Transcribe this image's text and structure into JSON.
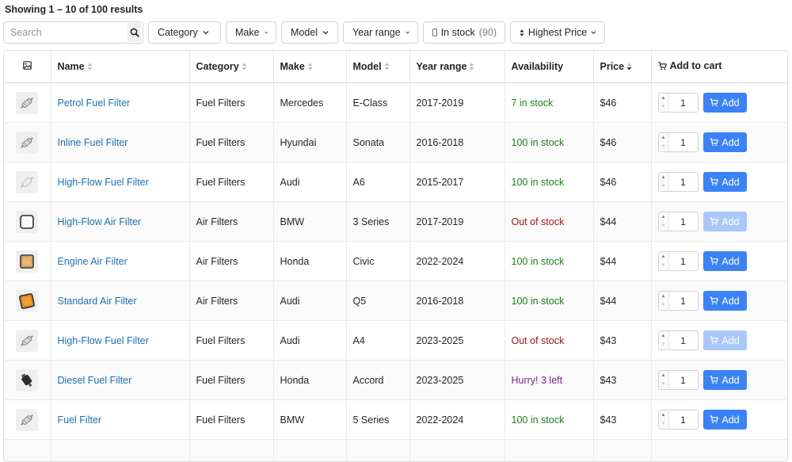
{
  "results_text": "Showing 1 – 10 of 100 results",
  "search": {
    "placeholder": "Search"
  },
  "filters": {
    "category": "Category",
    "make": "Make",
    "model": "Model",
    "year_range": "Year range",
    "in_stock_label": "In stock",
    "in_stock_count": "(90)",
    "sort": "Highest Price"
  },
  "columns": {
    "name": "Name",
    "category": "Category",
    "make": "Make",
    "model": "Model",
    "year_range": "Year range",
    "availability": "Availability",
    "price": "Price",
    "add_to_cart": "Add to cart"
  },
  "add_label": "Add",
  "rows": [
    {
      "name": "Petrol Fuel Filter",
      "category": "Fuel Filters",
      "make": "Mercedes",
      "model": "E-Class",
      "years": "2017-2019",
      "availability": "7 in stock",
      "status": "in",
      "price": "$46",
      "qty": "1",
      "thumb": "fuel"
    },
    {
      "name": "Inline Fuel Filter",
      "category": "Fuel Filters",
      "make": "Hyundai",
      "model": "Sonata",
      "years": "2016-2018",
      "availability": "100 in stock",
      "status": "in",
      "price": "$46",
      "qty": "1",
      "thumb": "fuel"
    },
    {
      "name": "High-Flow Fuel Filter",
      "category": "Fuel Filters",
      "make": "Audi",
      "model": "A6",
      "years": "2015-2017",
      "availability": "100 in stock",
      "status": "in",
      "price": "$46",
      "qty": "1",
      "thumb": "fuel-light"
    },
    {
      "name": "High-Flow Air Filter",
      "category": "Air Filters",
      "make": "BMW",
      "model": "3 Series",
      "years": "2017-2019",
      "availability": "Out of stock",
      "status": "out",
      "price": "$44",
      "qty": "1",
      "thumb": "air-white"
    },
    {
      "name": "Engine Air Filter",
      "category": "Air Filters",
      "make": "Honda",
      "model": "Civic",
      "years": "2022-2024",
      "availability": "100 in stock",
      "status": "in",
      "price": "$44",
      "qty": "1",
      "thumb": "air-tan"
    },
    {
      "name": "Standard Air Filter",
      "category": "Air Filters",
      "make": "Audi",
      "model": "Q5",
      "years": "2016-2018",
      "availability": "100 in stock",
      "status": "in",
      "price": "$44",
      "qty": "1",
      "thumb": "air-orange"
    },
    {
      "name": "High-Flow Fuel Filter",
      "category": "Fuel Filters",
      "make": "Audi",
      "model": "A4",
      "years": "2023-2025",
      "availability": "Out of stock",
      "status": "out",
      "price": "$43",
      "qty": "1",
      "thumb": "fuel"
    },
    {
      "name": "Diesel Fuel Filter",
      "category": "Fuel Filters",
      "make": "Honda",
      "model": "Accord",
      "years": "2023-2025",
      "availability": "Hurry! 3 left",
      "status": "low",
      "price": "$43",
      "qty": "1",
      "thumb": "fuel-black"
    },
    {
      "name": "Fuel Filter",
      "category": "Fuel Filters",
      "make": "BMW",
      "model": "5 Series",
      "years": "2022-2024",
      "availability": "100 in stock",
      "status": "in",
      "price": "$43",
      "qty": "1",
      "thumb": "fuel"
    },
    {
      "name": "",
      "category": "",
      "make": "",
      "model": "",
      "years": "",
      "availability": "",
      "status": "in",
      "price": "",
      "qty": "",
      "thumb": "none"
    }
  ],
  "colors": {
    "link": "#1f6fb2",
    "in_stock": "#1a7f1a",
    "out_of_stock": "#a31515",
    "low_stock": "#8a1c9c",
    "add_button": "#3b82f6",
    "add_button_disabled": "#a9c8f8"
  }
}
